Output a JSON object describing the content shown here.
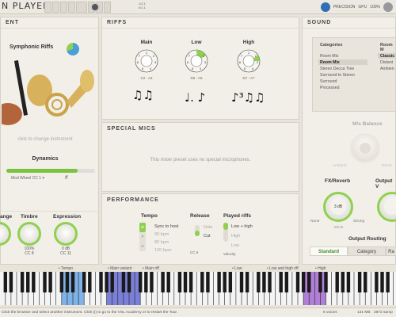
{
  "app": {
    "title": "N PLAYER"
  },
  "topbar": {
    "small_text": [
      "1/2.1",
      "0/1.1"
    ],
    "right_items": [
      "PRECISION",
      "GPU",
      "100%"
    ]
  },
  "instrument": {
    "header": "ENT",
    "name": "Symphonic Riffs",
    "click_hint": "click to change instrument",
    "dynamics": {
      "label": "Dynamics",
      "level": 0.8,
      "source": "Mod Wheel",
      "cc": "CC 1 ▾",
      "mark": "ff"
    },
    "knobs": [
      {
        "label": "ange",
        "value": ""
      },
      {
        "label": "Timbre",
        "value": "100%",
        "cc": "CC 8"
      },
      {
        "label": "Expression",
        "value": "0 dB",
        "cc": "CC 11"
      }
    ]
  },
  "riffs": {
    "header": "RIFFS",
    "groups": [
      {
        "name": "Main",
        "range": "C2 - A2"
      },
      {
        "name": "Low",
        "range": "D5 - A5"
      },
      {
        "name": "High",
        "range": "D7 - A7"
      }
    ],
    "notation": [
      "♫♫",
      "♩. ♪",
      "♪³♫♫"
    ]
  },
  "special_mics": {
    "header": "SPECIAL MICS",
    "note": "This mixer preset uses no special microphones."
  },
  "performance": {
    "header": "PERFORMANCE",
    "tempo": {
      "label": "Tempo",
      "options": [
        "Sync to host",
        "90 bpm",
        "80 bpm",
        "120 bpm"
      ],
      "selector": [
        "M",
        "P",
        "H"
      ]
    },
    "release": {
      "label": "Release",
      "options": [
        "Note",
        "Cut"
      ],
      "cc": "CC 6"
    },
    "played_riffs": {
      "label": "Played riffs",
      "options": [
        "Low + high",
        "High",
        "Low"
      ],
      "source": "Velocity"
    }
  },
  "sound": {
    "header": "SOUND",
    "categories_label": "Categories",
    "categories": [
      "Room Mix",
      "Room Mix",
      "Stereo Decca Tree",
      "Surround to Stereo",
      "Surround",
      "Processed"
    ],
    "selected_category": "Room Mix",
    "presets_label": "Room M",
    "presets": [
      "Classic",
      "Distant",
      "Ambien"
    ],
    "ms_balance": {
      "label": "M/s Balance",
      "left": "Ambient",
      "right": "Direct"
    },
    "fx_reverb": {
      "label": "FX/Reverb",
      "value": "3 dB",
      "left": "None",
      "right": "Strong",
      "cc": "CC 5"
    },
    "output_label": "Output V",
    "output_routing": {
      "label": "Output Routing",
      "tabs": [
        "Standard",
        "Category",
        "Ra"
      ],
      "selected": "Standard"
    }
  },
  "keyboard": {
    "tags": [
      "Tempo",
      "Main variant",
      "Main riff",
      "Low",
      "Low and high riff",
      "High"
    ]
  },
  "status": {
    "hint": "Click the browser and select another instrument. Click (i) to go to the VSL Academy or to restart the Tour.",
    "voices": "6 voices",
    "memory": "131 MB",
    "samples": "2872 samp"
  },
  "colors": {
    "accent": "#8fd14f",
    "key_blue": "#7fb2e6",
    "key_purple": "#7b7fd6",
    "key_pink": "#b07fd6"
  }
}
